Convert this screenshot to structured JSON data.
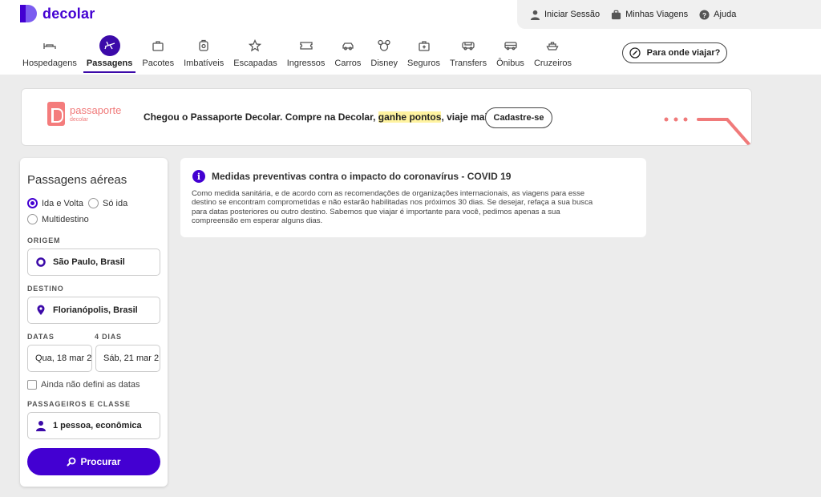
{
  "brand": {
    "name": "decolar",
    "accent": "#4300d2",
    "coral": "#f07a7a"
  },
  "top_links": [
    {
      "label": "Iniciar Sessão",
      "icon": "user-icon"
    },
    {
      "label": "Minhas Viagens",
      "icon": "suitcase-icon"
    },
    {
      "label": "Ajuda",
      "icon": "help-icon"
    }
  ],
  "nav": [
    {
      "label": "Hospedagens",
      "icon": "bed-icon",
      "active": false
    },
    {
      "label": "Passagens",
      "icon": "plane-icon",
      "active": true
    },
    {
      "label": "Pacotes",
      "icon": "package-icon",
      "active": false
    },
    {
      "label": "Imbatíveis",
      "icon": "tag-icon",
      "active": false
    },
    {
      "label": "Escapadas",
      "icon": "star-icon",
      "active": false
    },
    {
      "label": "Ingressos",
      "icon": "ticket-icon",
      "active": false
    },
    {
      "label": "Carros",
      "icon": "car-icon",
      "active": false
    },
    {
      "label": "Disney",
      "icon": "mickey-icon",
      "active": false
    },
    {
      "label": "Seguros",
      "icon": "insurance-icon",
      "active": false
    },
    {
      "label": "Transfers",
      "icon": "transfer-icon",
      "active": false
    },
    {
      "label": "Ônibus",
      "icon": "bus-icon",
      "active": false
    },
    {
      "label": "Cruzeiros",
      "icon": "ship-icon",
      "active": false
    }
  ],
  "where_button": {
    "label": "Para onde viajar?"
  },
  "banner": {
    "logo_name": "passaporte",
    "logo_sub": "decolar",
    "message_before": "Chegou o Passaporte Decolar. Compre na Decolar, ",
    "message_highlight": "ganhe pontos",
    "message_after": ", viaje mais.",
    "cta": "Cadastre-se"
  },
  "search": {
    "title": "Passagens aéreas",
    "trip_types": [
      {
        "label": "Ida e Volta",
        "selected": true
      },
      {
        "label": "Só ida",
        "selected": false
      },
      {
        "label": "Multidestino",
        "selected": false
      }
    ],
    "origin_label": "ORIGEM",
    "origin_value": "São Paulo, Brasil",
    "destination_label": "DESTINO",
    "destination_value": "Florianópolis, Brasil",
    "dates_label": "DATAS",
    "days_label": "4 DIAS",
    "date_depart": "Qua, 18 mar 2",
    "date_return": "Sáb, 21 mar 2",
    "no_dates_label": "Ainda não defini as datas",
    "passengers_label": "PASSAGEIROS E CLASSE",
    "passengers_value": "1 pessoa, econômica",
    "search_button": "Procurar"
  },
  "notice": {
    "title": "Medidas preventivas contra o impacto do coronavírus - COVID 19",
    "lines": [
      "Como medida sanitária, e de acordo com as recomendações de organizações internacionais, as viagens para esse",
      "destino se encontram comprometidas e não estarão habilitadas nos próximos 30 dias. Se desejar, refaça a sua busca",
      "para datas posteriores ou outro destino. Sabemos que viajar é importante para você, pedimos apenas a sua",
      "compreensão em esperar alguns dias."
    ]
  }
}
